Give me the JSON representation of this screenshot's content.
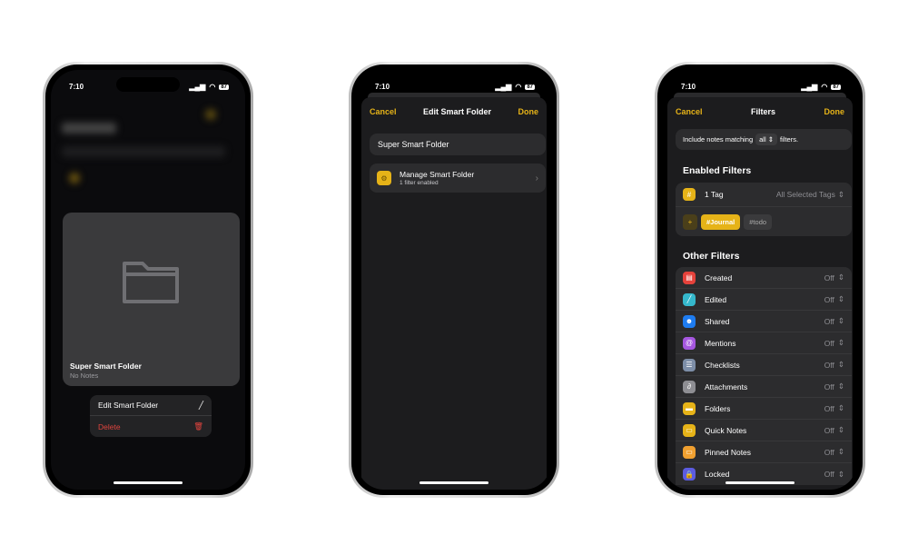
{
  "status": {
    "time": "7:10",
    "battery": "87"
  },
  "phone1": {
    "card": {
      "title": "Super Smart Folder",
      "subtitle": "No Notes"
    },
    "menu": [
      {
        "label": "Edit Smart Folder",
        "icon": "pencil-icon",
        "color": "#ffffff"
      },
      {
        "label": "Delete",
        "icon": "trash-icon",
        "color": "#e0443e"
      }
    ]
  },
  "phone2": {
    "nav": {
      "cancel": "Cancel",
      "title": "Edit Smart Folder",
      "done": "Done"
    },
    "name_value": "Super Smart Folder",
    "manage": {
      "title": "Manage Smart Folder",
      "subtitle": "1 filter enabled",
      "icon": "gear-icon"
    }
  },
  "phone3": {
    "nav": {
      "cancel": "Cancel",
      "title": "Filters",
      "done": "Done"
    },
    "include": {
      "prefix": "Include notes matching",
      "value": "all",
      "suffix": "filters."
    },
    "enabled_heading": "Enabled Filters",
    "tag_filter": {
      "label": "1 Tag",
      "value": "All Selected Tags",
      "tags": [
        {
          "label": "#Journal",
          "selected": true
        },
        {
          "label": "#todo",
          "selected": false
        }
      ]
    },
    "other_heading": "Other Filters",
    "filters": [
      {
        "label": "Created",
        "value": "Off",
        "icon": "calendar-icon",
        "color": "#e5423b"
      },
      {
        "label": "Edited",
        "value": "Off",
        "icon": "pencil-icon",
        "color": "#35b8cc"
      },
      {
        "label": "Shared",
        "value": "Off",
        "icon": "people-icon",
        "color": "#1e7cf0"
      },
      {
        "label": "Mentions",
        "value": "Off",
        "icon": "at-icon",
        "color": "#a657e0"
      },
      {
        "label": "Checklists",
        "value": "Off",
        "icon": "checklist-icon",
        "color": "#7d8ea8"
      },
      {
        "label": "Attachments",
        "value": "Off",
        "icon": "paperclip-icon",
        "color": "#8e8e93"
      },
      {
        "label": "Folders",
        "value": "Off",
        "icon": "folder-icon",
        "color": "#e6b318"
      },
      {
        "label": "Quick Notes",
        "value": "Off",
        "icon": "quick-note-icon",
        "color": "#e6b318"
      },
      {
        "label": "Pinned Notes",
        "value": "Off",
        "icon": "pin-icon",
        "color": "#f0a030"
      },
      {
        "label": "Locked",
        "value": "Off",
        "icon": "lock-icon",
        "color": "#5c5ce0"
      }
    ]
  },
  "colors": {
    "accent": "#e6b318",
    "destructive": "#e0443e"
  }
}
